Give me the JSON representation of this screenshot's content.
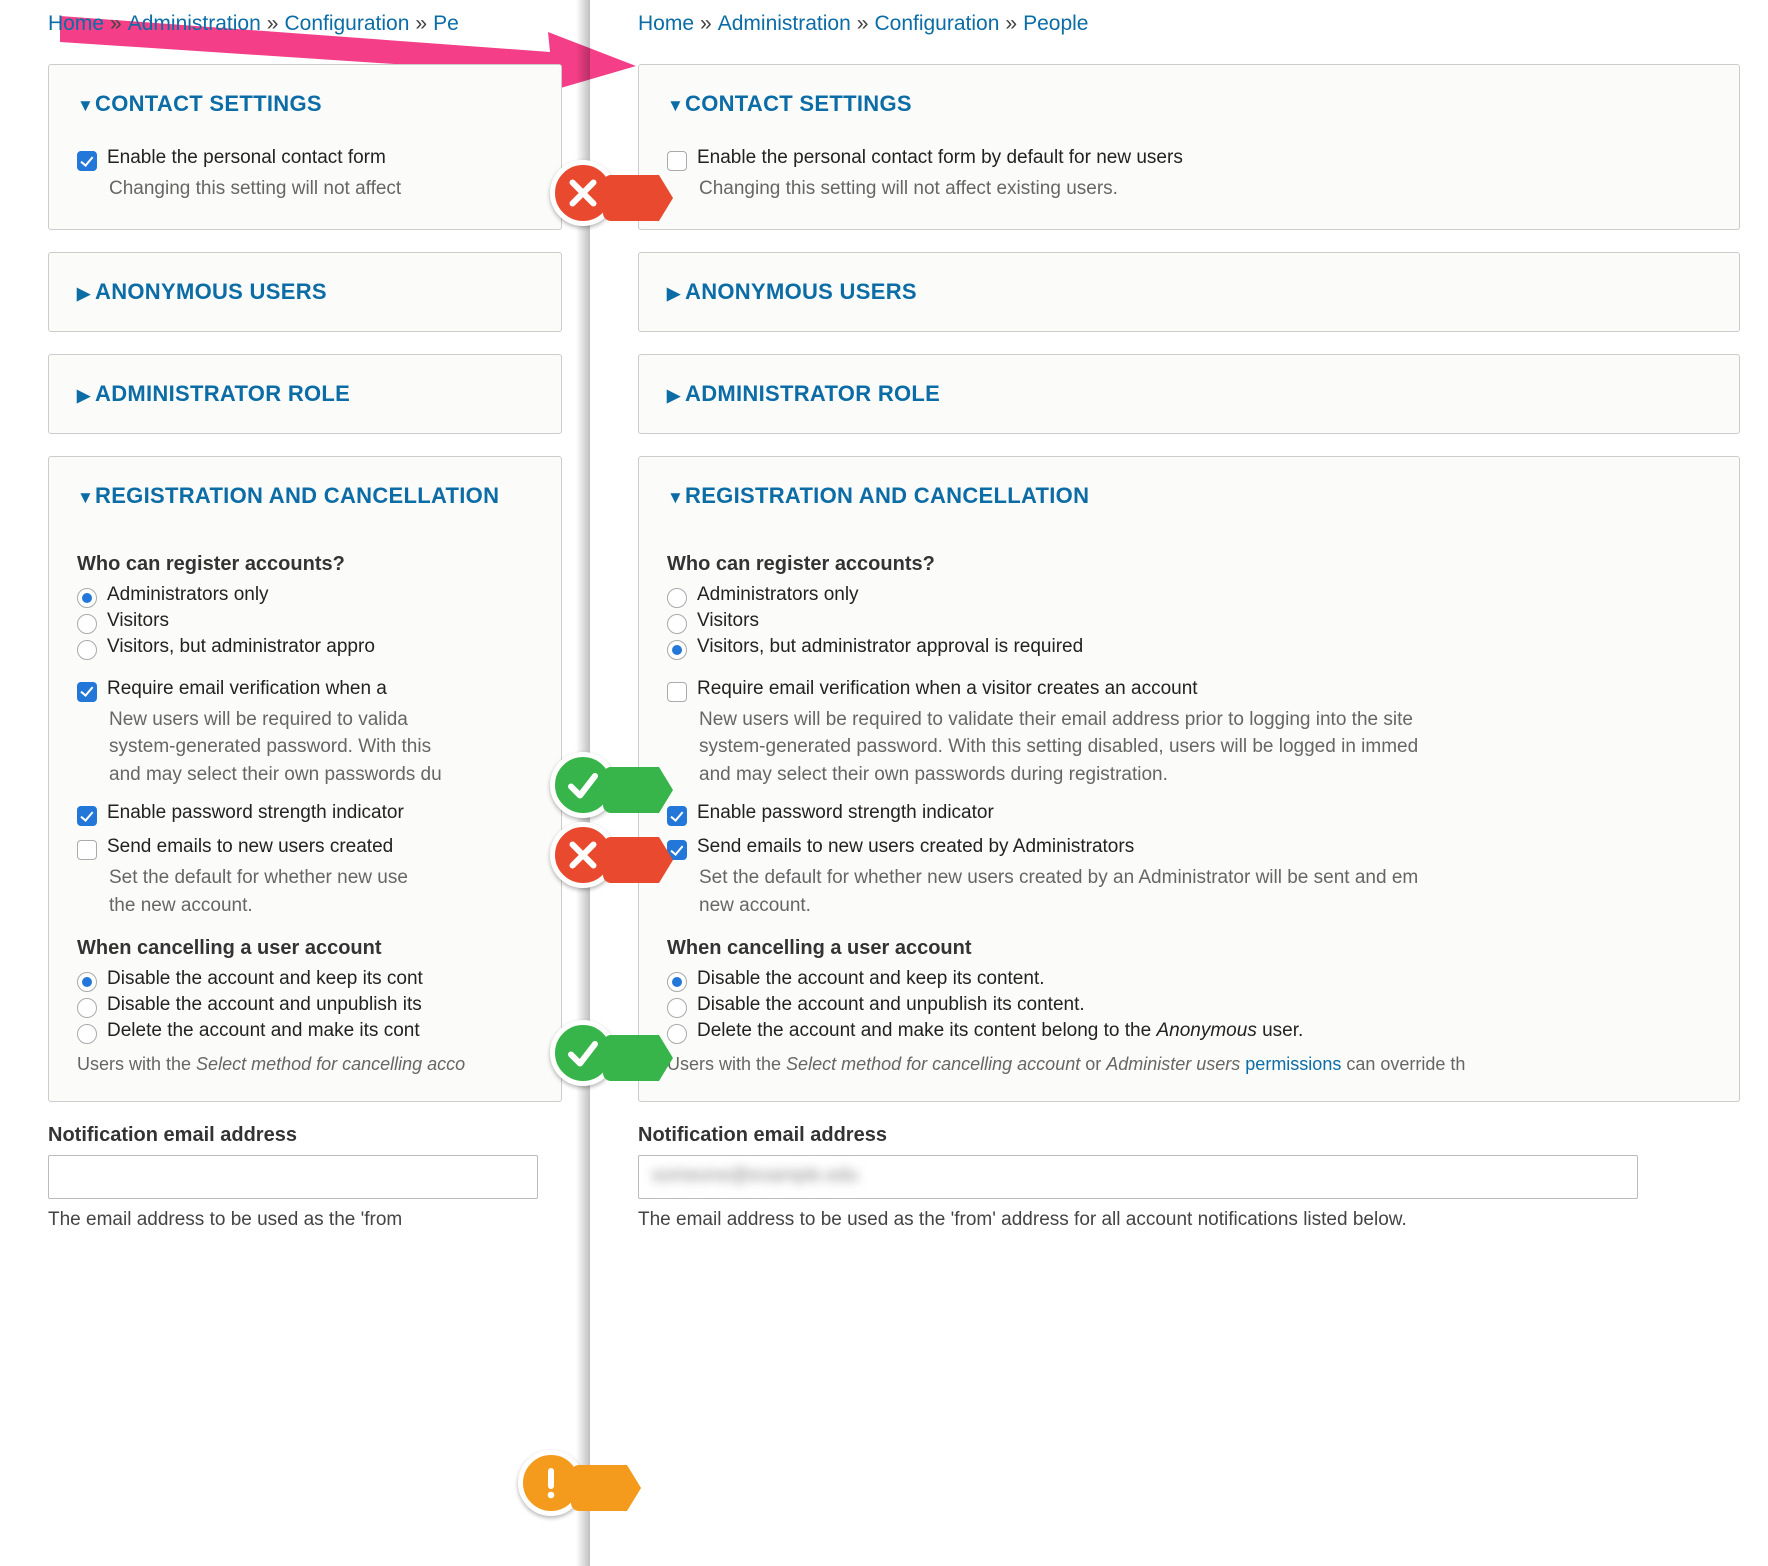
{
  "breadcrumb": {
    "home": "Home",
    "admin": "Administration",
    "config": "Configuration",
    "people": "People",
    "people_short": "Pe"
  },
  "panels": {
    "contact": {
      "title": "CONTACT SETTINGS",
      "enable_label": "Enable the personal contact form by default for new users",
      "enable_label_short": "Enable the personal contact form",
      "enable_desc": "Changing this setting will not affect existing users.",
      "enable_desc_short": "Changing this setting will not affect"
    },
    "anon": {
      "title": "ANONYMOUS USERS"
    },
    "admin": {
      "title": "ADMINISTRATOR ROLE"
    },
    "reg": {
      "title": "REGISTRATION AND CANCELLATION",
      "title_short": "REGISTRATION AND CANCELLATION",
      "who_q": "Who can register accounts?",
      "who_admin": "Administrators only",
      "who_visitors": "Visitors",
      "who_visitors_approval": "Visitors, but administrator approval is required",
      "who_visitors_approval_short": "Visitors, but administrator appro",
      "require_email": "Require email verification when a visitor creates an account",
      "require_email_short": "Require email verification when a",
      "require_email_desc": "New users will be required to validate their email address prior to logging into the site, and will be assigned a system-generated password. With this setting disabled, users will be logged in immediately upon registering, and may select their own passwords during registration.",
      "require_email_desc_l1_left": "New users will be required to valida",
      "require_email_desc_l2_left": "system-generated password. With this",
      "require_email_desc_l3_left": "and may select their own passwords du",
      "require_email_desc_l1_right": "New users will be required to validate their email address prior to logging into the site",
      "require_email_desc_l2_right": "system-generated password. With this setting disabled, users will be logged in immed",
      "require_email_desc_l3_right": "and may select their own passwords during registration.",
      "pwd_strength": "Enable password strength indicator",
      "send_emails": "Send emails to new users created by Administrators",
      "send_emails_short": "Send emails to new users created",
      "send_emails_desc_left_l1": "Set the default for whether new use",
      "send_emails_desc_left_l2": "the new account.",
      "send_emails_desc_right_l1": "Set the default for whether new users created by an Administrator will be sent and em",
      "send_emails_desc_right_l2": "new account.",
      "cancel_q": "When cancelling a user account",
      "cancel_disable_keep": "Disable the account and keep its content.",
      "cancel_disable_keep_short": "Disable the account and keep its cont",
      "cancel_disable_unpub": "Disable the account and unpublish its content.",
      "cancel_disable_unpub_short": "Disable the account and unpublish its",
      "cancel_delete_anon_pre": "Delete the account and make its content belong to the ",
      "cancel_delete_anon_short": "Delete the account and make its cont",
      "anon_word": "Anonymous",
      "anon_suffix": " user.",
      "perm_note_pre_left": "Users with the ",
      "perm_note_em_left": "Select method for cancelling acco",
      "perm_note_pre_right": "Users with the ",
      "perm_note_em1_right": "Select method for cancelling account",
      "perm_note_or": " or ",
      "perm_note_em2_right": "Administer users",
      "perm_note_link": "permissions",
      "perm_note_post_right": " can override th"
    }
  },
  "notification": {
    "label": "Notification email address",
    "value_blurred": "someone@example.edu",
    "help_left": "The email address to be used as the 'from",
    "help_right": "The email address to be used as the 'from' address for all account notifications listed below."
  },
  "state": {
    "left": {
      "contact_enabled": true,
      "who": "admin",
      "require_email": true,
      "pwd_strength": true,
      "send_emails": false,
      "cancel": "disable_keep"
    },
    "right": {
      "contact_enabled": false,
      "who": "visitors_approval",
      "require_email": false,
      "pwd_strength": true,
      "send_emails": true,
      "cancel": "disable_keep"
    }
  }
}
